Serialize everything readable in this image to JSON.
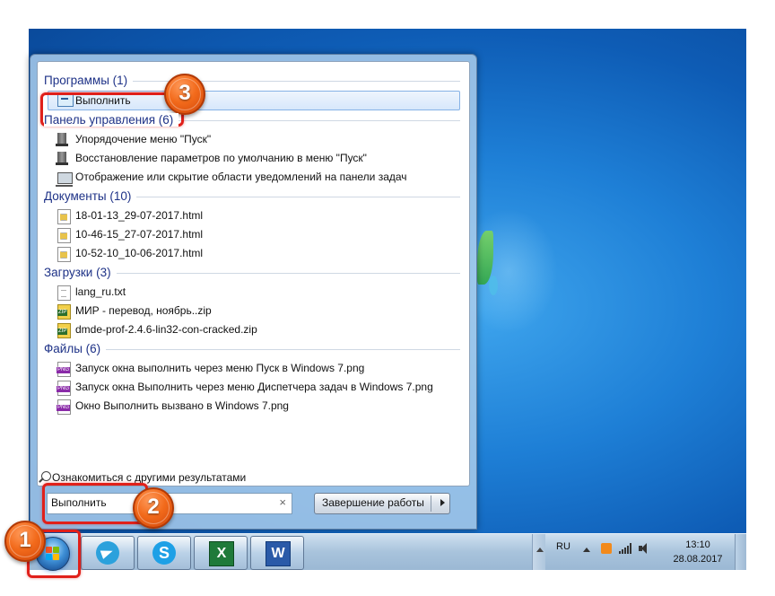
{
  "start_menu": {
    "groups": [
      {
        "header": "Программы (1)",
        "items": [
          {
            "label": "Выполнить",
            "icon": "run-icon",
            "selected": true
          }
        ]
      },
      {
        "header": "Панель управления (6)",
        "items": [
          {
            "label": "Упорядочение меню \"Пуск\"",
            "icon": "control-panel-icon"
          },
          {
            "label": "Восстановление параметров по умолчанию в меню \"Пуск\"",
            "icon": "control-panel-icon"
          },
          {
            "label": "Отображение или скрытие области уведомлений на панели задач",
            "icon": "monitor-icon"
          }
        ]
      },
      {
        "header": "Документы (10)",
        "items": [
          {
            "label": "18-01-13_29-07-2017.html",
            "icon": "html-file-icon"
          },
          {
            "label": "10-46-15_27-07-2017.html",
            "icon": "html-file-icon"
          },
          {
            "label": "10-52-10_10-06-2017.html",
            "icon": "html-file-icon"
          }
        ]
      },
      {
        "header": "Загрузки (3)",
        "items": [
          {
            "label": "lang_ru.txt",
            "icon": "text-file-icon"
          },
          {
            "label": "МИР - перевод, ноябрь..zip",
            "icon": "zip-file-icon"
          },
          {
            "label": "dmde-prof-2.4.6-lin32-con-cracked.zip",
            "icon": "zip-file-icon"
          }
        ]
      },
      {
        "header": "Файлы (6)",
        "items": [
          {
            "label": "Запуск окна выполнить через меню Пуск в Windows 7.png",
            "icon": "png-file-icon"
          },
          {
            "label": "Запуск окна Выполнить через меню Диспетчера задач в Windows 7.png",
            "icon": "png-file-icon"
          },
          {
            "label": "Окно Выполнить вызвано в Windows 7.png",
            "icon": "png-file-icon"
          }
        ]
      }
    ],
    "more_results": "Ознакомиться с другими результатами",
    "search_value": "Выполнить",
    "clear_symbol": "×",
    "shutdown_label": "Завершение работы"
  },
  "taskbar": {
    "apps": [
      {
        "name": "telegram",
        "glyph": ""
      },
      {
        "name": "skype",
        "glyph": "S"
      },
      {
        "name": "excel",
        "glyph": "X"
      },
      {
        "name": "word",
        "glyph": "W"
      }
    ],
    "language": "RU",
    "time": "13:10",
    "date": "28.08.2017"
  },
  "callouts": [
    {
      "number": "1"
    },
    {
      "number": "2"
    },
    {
      "number": "3"
    }
  ],
  "colors": {
    "accent_badge": "#f26a1b",
    "highlight_border": "#e0201a",
    "group_header": "#1e3287"
  }
}
